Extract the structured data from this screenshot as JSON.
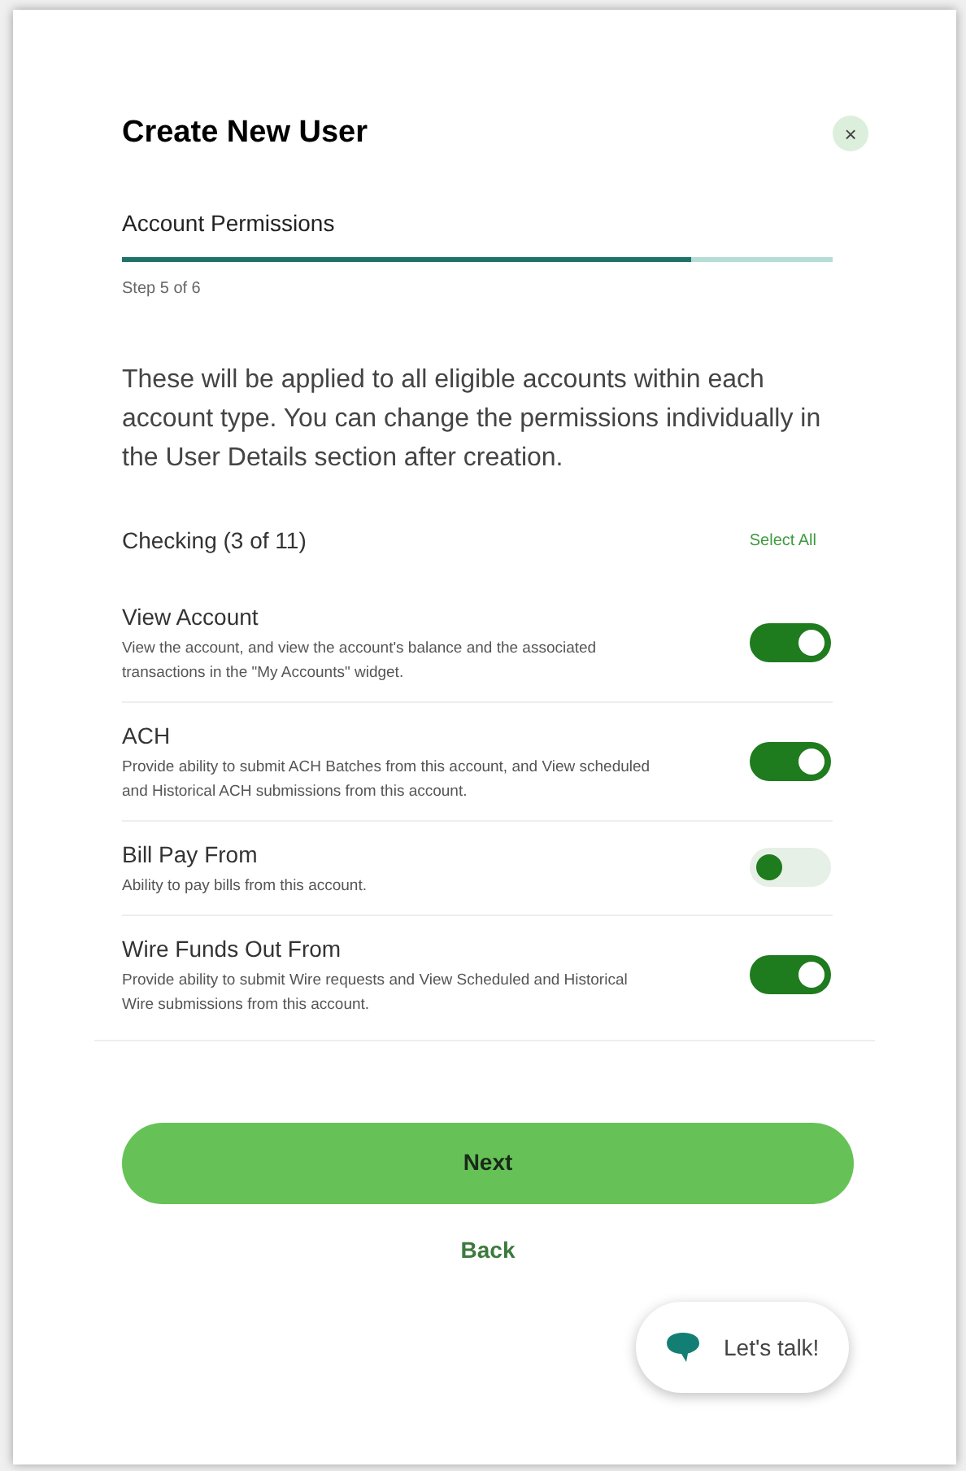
{
  "dialog": {
    "title": "Create New User",
    "close": "×"
  },
  "step": {
    "title": "Account Permissions",
    "level": 0.8,
    "label": "Step 5 of 6"
  },
  "intro": "These will be applied to all eligible accounts within each account type. You can change the permissions individually in the User Details section after creation.",
  "section": {
    "title": "Checking (3 of 11)",
    "action": "Select All"
  },
  "permissions": [
    {
      "name": "View Account",
      "description": "View the account, and view the account's balance and the associated transactions in the \"My Accounts\" widget.",
      "on": true
    },
    {
      "name": "ACH",
      "description": "Provide ability to submit ACH Batches from this account, and View scheduled and Historical ACH submissions from this account.",
      "on": true
    },
    {
      "name": "Bill Pay From",
      "description": "Ability to pay bills from this account.",
      "on": false
    },
    {
      "name": "Wire Funds Out From",
      "description": "Provide ability to submit Wire requests and View Scheduled and Historical Wire submissions from this account.",
      "on": true
    }
  ],
  "buttons": {
    "next": "Next",
    "back": "Back"
  },
  "chat": {
    "label": "Let's talk!"
  }
}
